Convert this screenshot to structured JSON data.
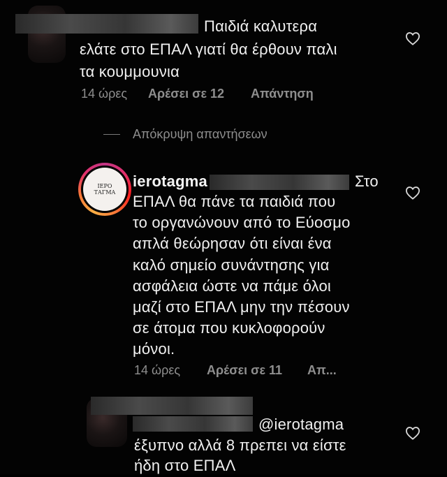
{
  "comment1": {
    "text_line1": "Παιδιά καλυτερα",
    "text_line2": "ελάτε στο ΕΠΑΛ γιατί θα έρθουν παλι",
    "text_line3": "τα κουμμουνια",
    "time": "14 ώρες",
    "likes": "Αρέσει σε 12",
    "reply": "Απάντηση"
  },
  "replies_toggle": {
    "label": "Απόκρυψη απαντήσεων"
  },
  "comment2": {
    "avatar_text_line1": "ΙΕΡΟ",
    "avatar_text_line2": "ΤΑΓΜΑ",
    "username": "ierotagma",
    "text_line1": "Στο",
    "text_line2": "ΕΠΑΛ θα πάνε τα παιδιά που",
    "text_line3": "το οργανώνουν από το Εύοσμο",
    "text_line4": "απλά θεώρησαν ότι είναι ένα",
    "text_line5": "καλό σημείο συνάντησης για",
    "text_line6": "ασφάλεια ώστε να πάμε όλοι",
    "text_line7": "μαζί στο ΕΠΑΛ μην την πέσουν",
    "text_line8": "σε άτομα που κυκλοφορούν",
    "text_line9": "μόνοι.",
    "time": "14 ώρες",
    "likes": "Αρέσει σε 11",
    "reply": "Απ..."
  },
  "comment3": {
    "mention": "@ierotagma",
    "text_line2": "έξυπνο αλλά 8 πρεπει να είστε",
    "text_line3": "ήδη στο ΕΠΑΛ"
  },
  "icons": {
    "heart": "heart-outline-icon"
  },
  "colors": {
    "background": "#030303",
    "text": "#f0f0f0",
    "muted": "#8e8e8e"
  }
}
